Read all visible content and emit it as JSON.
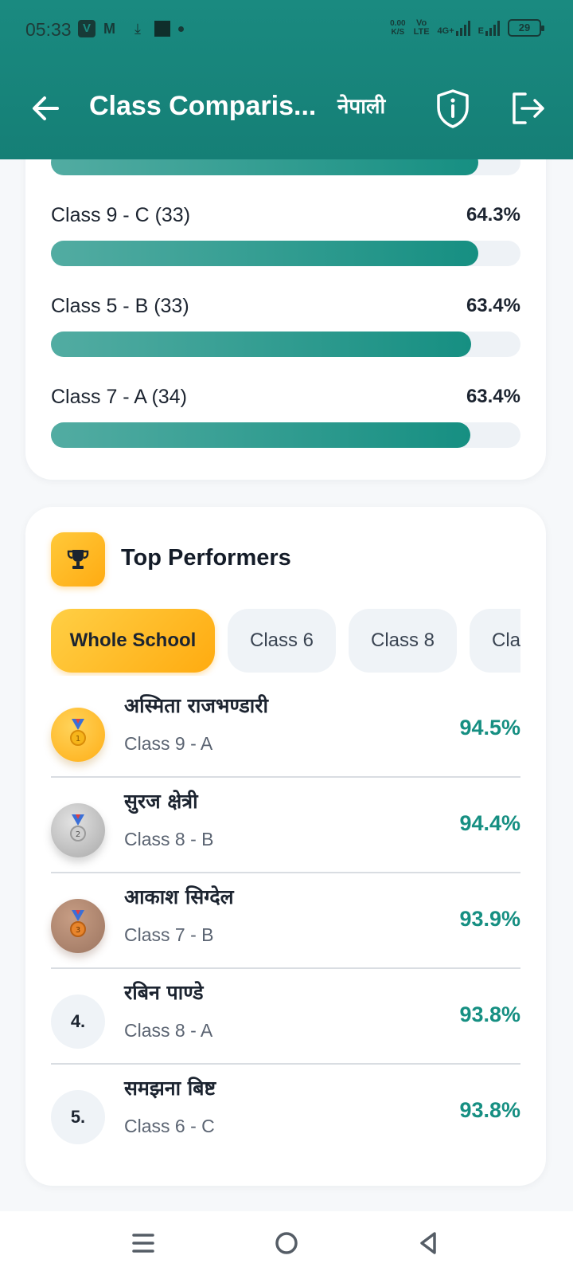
{
  "status_bar": {
    "time": "05:33",
    "net_speed_value": "0.00",
    "net_speed_unit": "K/S",
    "volte_top": "Vo",
    "volte_bottom": "LTE",
    "network_type": "4G+",
    "network_type_2": "E",
    "battery": "29",
    "icons": [
      "v-app-icon",
      "gmail-icon",
      "download-icon",
      "square-app-icon",
      "dot-icon",
      "signal-icon",
      "battery-icon"
    ]
  },
  "header": {
    "title": "Class Comparis...",
    "language_label": "नेपाली",
    "icons": [
      "back-arrow-icon",
      "shield-info-icon",
      "logout-icon"
    ],
    "color": "#1a8a80"
  },
  "class_ranking": {
    "partial_fill": 0.91,
    "rows": [
      {
        "label": "Class 9 - C (33)",
        "percent": "64.3%",
        "fill": 0.91
      },
      {
        "label": "Class 5 - B (33)",
        "percent": "63.4%",
        "fill": 0.895
      },
      {
        "label": "Class 7 - A (34)",
        "percent": "63.4%",
        "fill": 0.894
      }
    ],
    "fill_color": "#168f82"
  },
  "top_performers": {
    "title": "Top Performers",
    "icon": "trophy-icon",
    "filters": [
      "Whole School",
      "Class 6",
      "Class 8",
      "Cla"
    ],
    "active_filter": "Whole School",
    "students": [
      {
        "rank": "1",
        "badge": "gold-medal-icon",
        "name": "अस्मिता राजभण्डारी",
        "class": "Class 9 - A",
        "score": "94.5%"
      },
      {
        "rank": "2",
        "badge": "silver-medal-icon",
        "name": "सुरज क्षेत्री",
        "class": "Class 8 - B",
        "score": "94.4%"
      },
      {
        "rank": "3",
        "badge": "bronze-medal-icon",
        "name": "आकाश सिग्देल",
        "class": "Class 7 - B",
        "score": "93.9%"
      },
      {
        "rank": "4.",
        "badge": "",
        "name": "रबिन पाण्डे",
        "class": "Class 8 - A",
        "score": "93.8%"
      },
      {
        "rank": "5.",
        "badge": "",
        "name": "समझना बिष्ट",
        "class": "Class 6 - C",
        "score": "93.8%"
      }
    ],
    "accent_color": "#ffb21c",
    "score_color": "#168f82"
  },
  "nav_bar": {
    "icons": [
      "menu-icon",
      "home-icon",
      "back-triangle-icon"
    ]
  }
}
